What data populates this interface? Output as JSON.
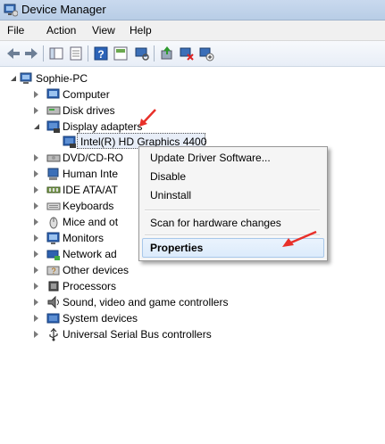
{
  "window": {
    "title": "Device Manager"
  },
  "menu": {
    "file": "File",
    "action": "Action",
    "view": "View",
    "help": "Help"
  },
  "toolbar": {
    "buttons": [
      "back-icon",
      "forward-icon",
      "show-hide-console-tree-icon",
      "properties-icon",
      "help-icon",
      "view-resources-icon",
      "scan-hardware-icon",
      "update-driver-icon",
      "disable-device-icon",
      "uninstall-device-icon"
    ]
  },
  "tree": {
    "root": "Sophie-PC",
    "items": [
      "Computer",
      "Disk drives",
      "Display adapters",
      "Intel(R) HD Graphics 4400",
      "DVD/CD-RO",
      "Human Inte",
      "IDE ATA/AT",
      "Keyboards",
      "Mice and ot",
      "Monitors",
      "Network ad",
      "Other devices",
      "Processors",
      "Sound, video and game controllers",
      "System devices",
      "Universal Serial Bus controllers"
    ]
  },
  "context_menu": {
    "update": "Update Driver Software...",
    "disable": "Disable",
    "uninstall": "Uninstall",
    "scan": "Scan for hardware changes",
    "properties": "Properties"
  },
  "colors": {
    "annotation_arrow": "#e8302a",
    "selection_border": "#a8c8ea"
  }
}
